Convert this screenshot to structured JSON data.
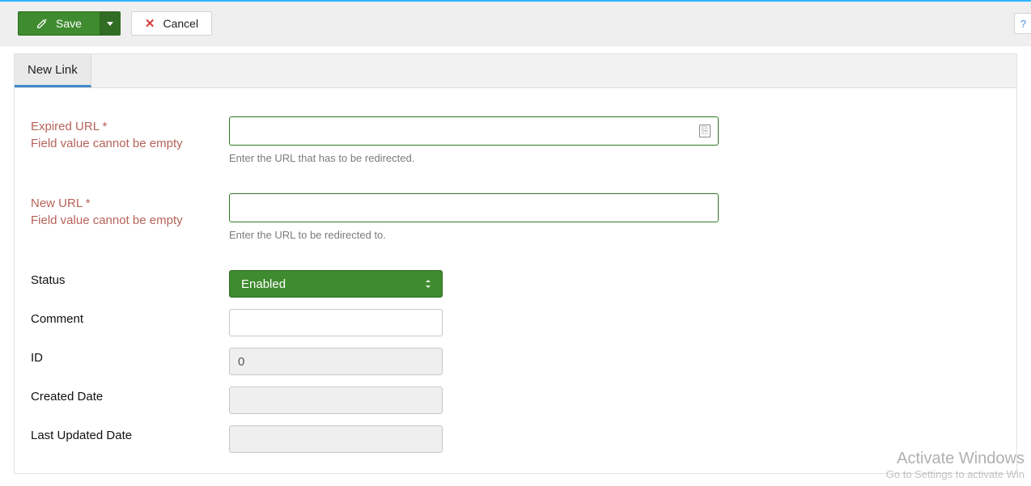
{
  "toolbar": {
    "save_label": "Save",
    "cancel_label": "Cancel",
    "help_label": "?"
  },
  "tab": {
    "title": "New Link"
  },
  "form": {
    "expired_url": {
      "label": "Expired URL *",
      "error": "Field value cannot be empty",
      "helper": "Enter the URL that has to be redirected.",
      "value": ""
    },
    "new_url": {
      "label": "New URL *",
      "error": "Field value cannot be empty",
      "helper": "Enter the URL to be redirected to.",
      "value": ""
    },
    "status": {
      "label": "Status",
      "value": "Enabled"
    },
    "comment": {
      "label": "Comment",
      "value": ""
    },
    "id": {
      "label": "ID",
      "value": "0"
    },
    "created": {
      "label": "Created Date",
      "value": ""
    },
    "updated": {
      "label": "Last Updated Date",
      "value": ""
    }
  },
  "watermark": {
    "title": "Activate Windows",
    "sub": "Go to Settings to activate Win"
  }
}
